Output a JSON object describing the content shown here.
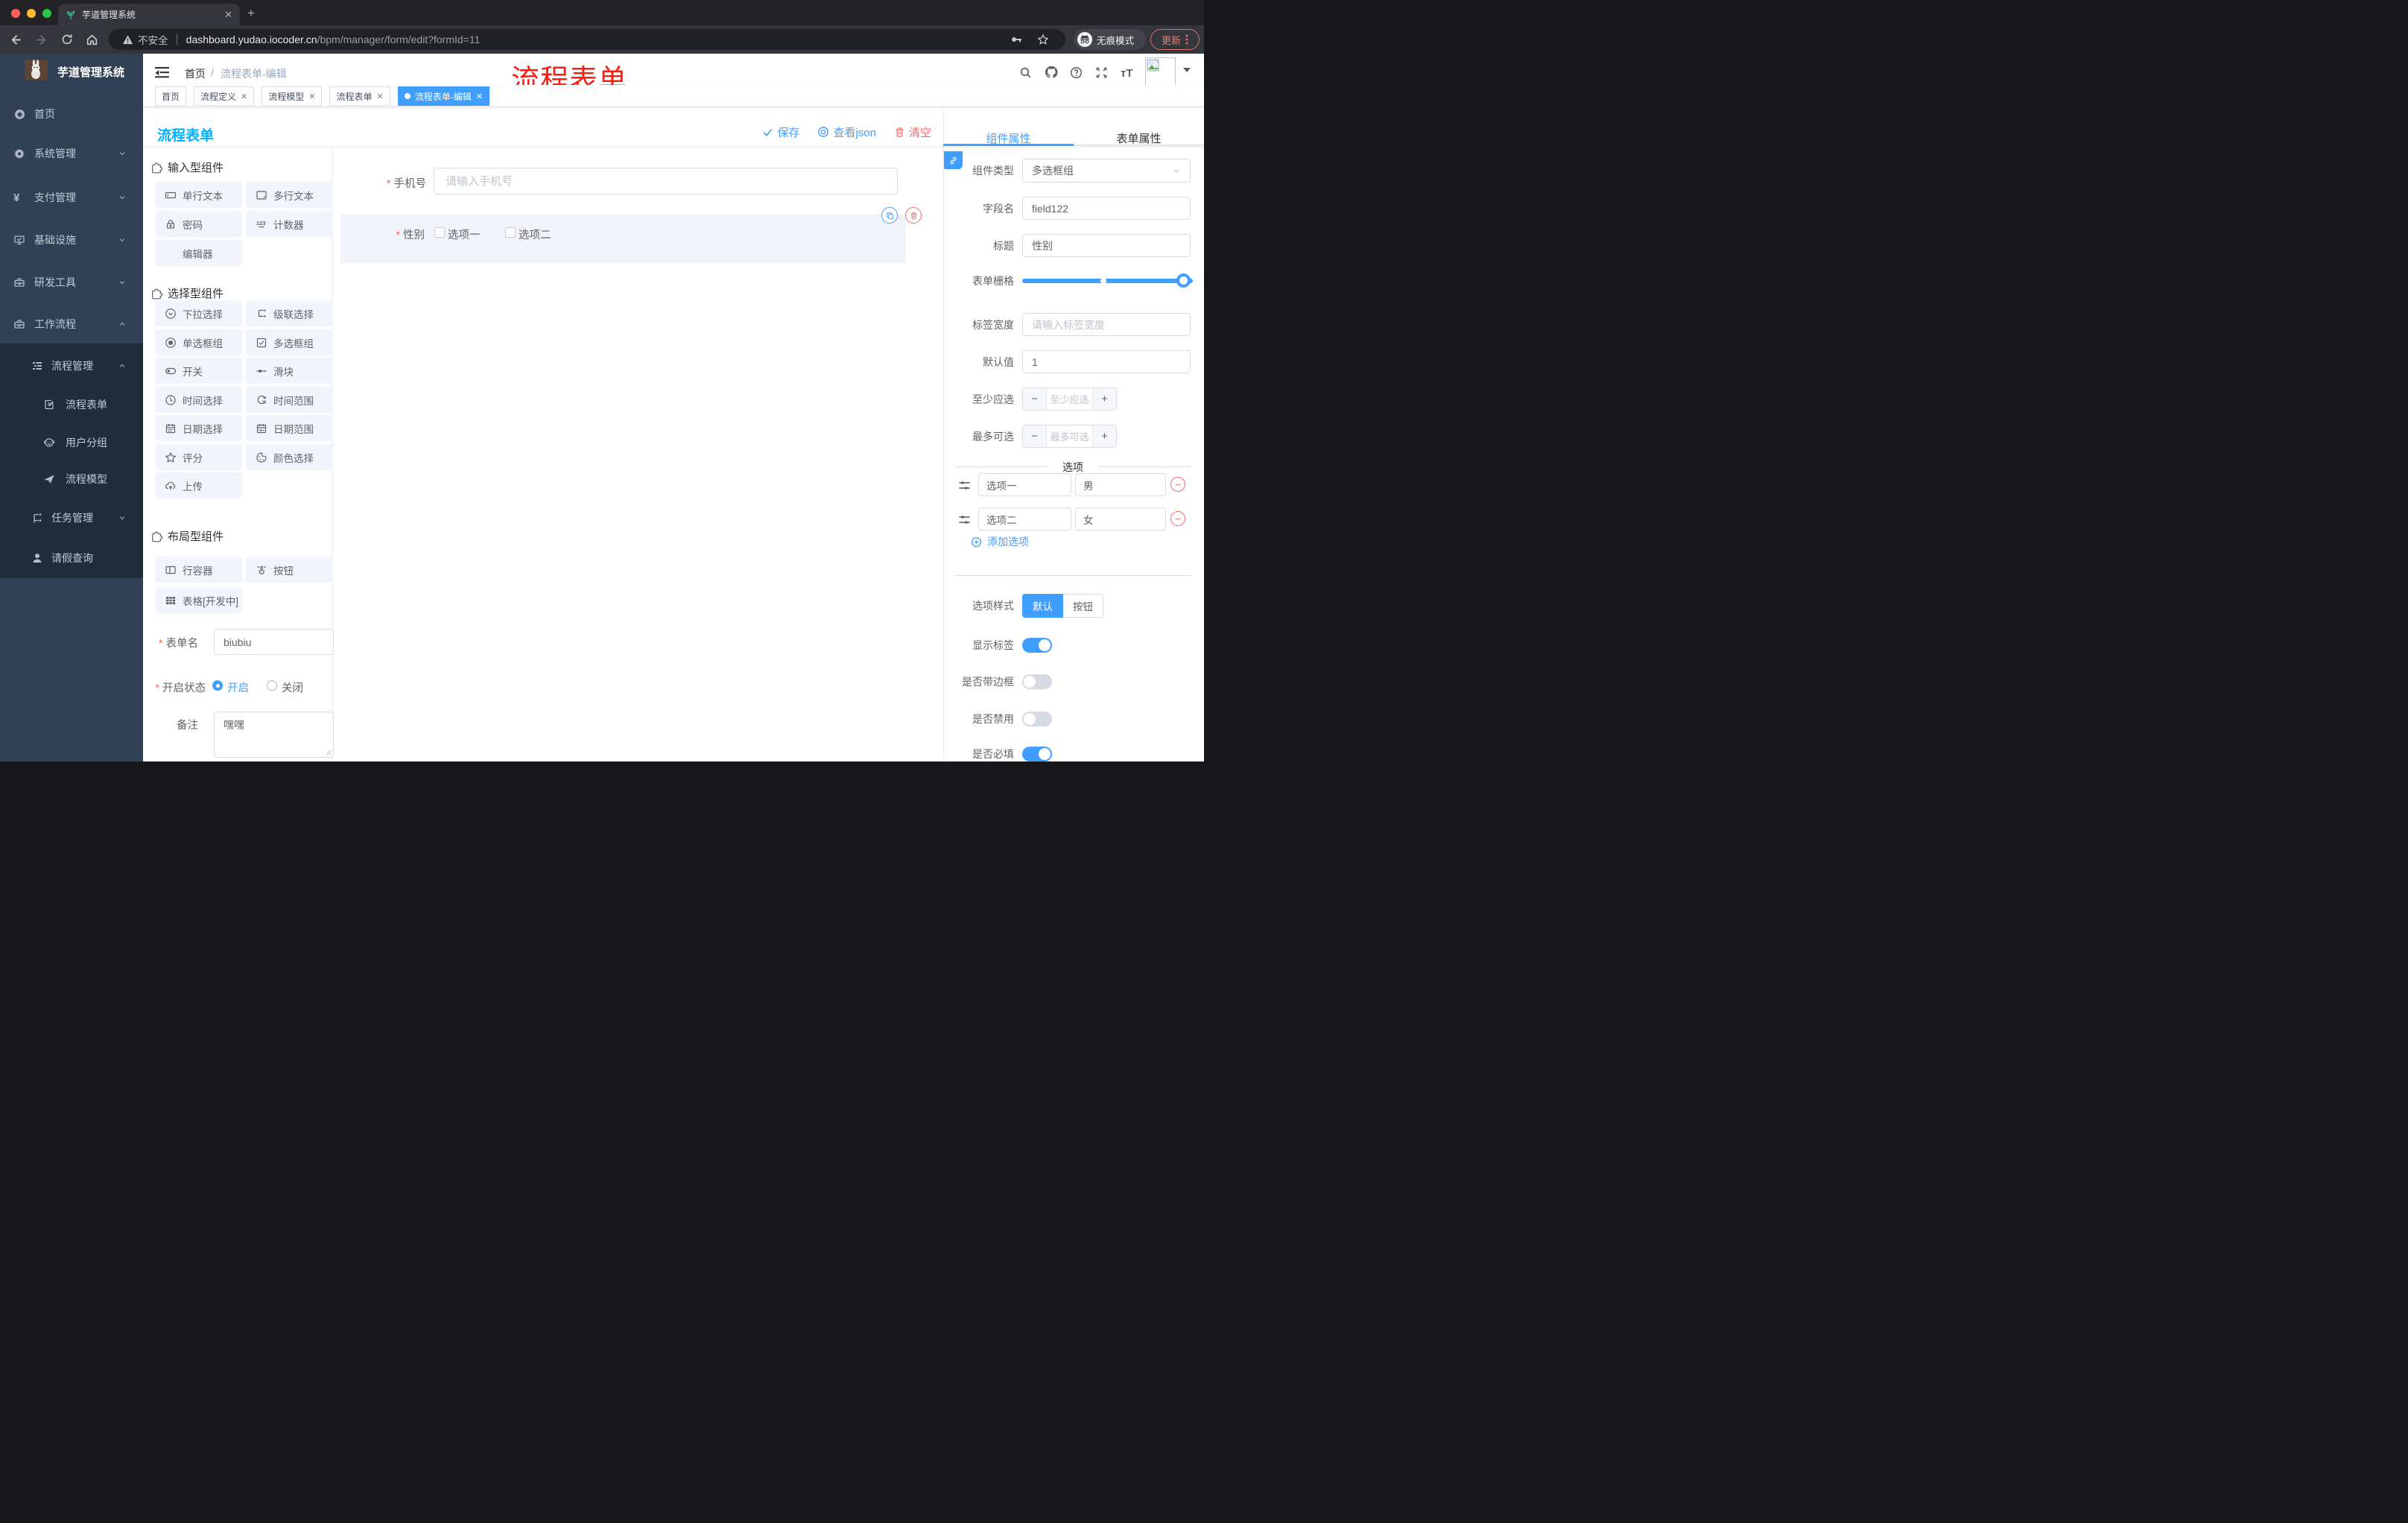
{
  "browser": {
    "tab_title": "芋道管理系统",
    "security_label": "不安全",
    "url_host": "dashboard.yudao.iocoder.cn",
    "url_path": "/bpm/manager/form/edit?formId=11",
    "incognito_label": "无痕模式",
    "update_label": "更新"
  },
  "sidebar": {
    "logo_title": "芋道管理系统",
    "items": [
      {
        "label": "首页"
      },
      {
        "label": "系统管理"
      },
      {
        "label": "支付管理"
      },
      {
        "label": "基础设施"
      },
      {
        "label": "研发工具"
      },
      {
        "label": "工作流程"
      },
      {
        "label": "流程管理"
      },
      {
        "label": "流程表单"
      },
      {
        "label": "用户分组"
      },
      {
        "label": "流程模型"
      },
      {
        "label": "任务管理"
      },
      {
        "label": "请假查询"
      }
    ]
  },
  "header": {
    "breadcrumb_home": "首页",
    "breadcrumb_current": "流程表单-编辑",
    "overlay_title": "流程表单"
  },
  "tags_view": {
    "tabs": [
      {
        "label": "首页"
      },
      {
        "label": "流程定义"
      },
      {
        "label": "流程模型"
      },
      {
        "label": "流程表单"
      },
      {
        "label": "流程表单-编辑"
      }
    ]
  },
  "designer": {
    "panel_title": "流程表单",
    "toolbar": {
      "save": "保存",
      "view_json": "查看json",
      "clear": "清空"
    },
    "palette": {
      "sections": [
        {
          "title": "输入型组件",
          "items": [
            {
              "label": "单行文本"
            },
            {
              "label": "多行文本"
            },
            {
              "label": "密码"
            },
            {
              "label": "计数器"
            },
            {
              "label": "编辑器"
            }
          ]
        },
        {
          "title": "选择型组件",
          "items": [
            {
              "label": "下拉选择"
            },
            {
              "label": "级联选择"
            },
            {
              "label": "单选框组"
            },
            {
              "label": "多选框组"
            },
            {
              "label": "开关"
            },
            {
              "label": "滑块"
            },
            {
              "label": "时间选择"
            },
            {
              "label": "时间范围"
            },
            {
              "label": "日期选择"
            },
            {
              "label": "日期范围"
            },
            {
              "label": "评分"
            },
            {
              "label": "颜色选择"
            },
            {
              "label": "上传"
            }
          ]
        },
        {
          "title": "布局型组件",
          "items": [
            {
              "label": "行容器"
            },
            {
              "label": "按钮"
            },
            {
              "label": "表格[开发中]"
            }
          ]
        }
      ]
    },
    "meta": {
      "form_name_label": "表单名",
      "form_name_value": "biubiu",
      "status_label": "开启状态",
      "status_on": "开启",
      "status_off": "关闭",
      "remark_label": "备注",
      "remark_value": "嘿嘿"
    },
    "canvas": {
      "phone_label": "手机号",
      "phone_placeholder": "请输入手机号",
      "gender_label": "性别",
      "gender_options": [
        {
          "label": "选项一"
        },
        {
          "label": "选项二"
        }
      ]
    }
  },
  "props": {
    "tab_component": "组件属性",
    "tab_form": "表单属性",
    "component_type_label": "组件类型",
    "component_type_value": "多选框组",
    "field_name_label": "字段名",
    "field_name_value": "field122",
    "title_label": "标题",
    "title_value": "性别",
    "grid_label": "表单栅格",
    "label_width_label": "标签宽度",
    "label_width_placeholder": "请输入标签宽度",
    "default_label": "默认值",
    "default_value": "1",
    "min_label": "至少应选",
    "min_placeholder": "至少应选",
    "max_label": "最多可选",
    "max_placeholder": "最多可选",
    "options_title": "选项",
    "options": [
      {
        "label": "选项一",
        "value": "男"
      },
      {
        "label": "选项二",
        "value": "女"
      }
    ],
    "add_option": "添加选项",
    "style_label": "选项样式",
    "style_default": "默认",
    "style_button": "按钮",
    "switch_show_label": "显示标签",
    "switch_border": "是否带边框",
    "switch_disabled": "是否禁用",
    "switch_required": "是否必填"
  },
  "colors": {
    "accent": "#409eff",
    "danger": "#f56c6c",
    "panel_title": "#00b2fe",
    "overlay_red": "#fb1c10",
    "sidebar_bg": "#304156",
    "submenu_bg": "#1f2d3d"
  }
}
